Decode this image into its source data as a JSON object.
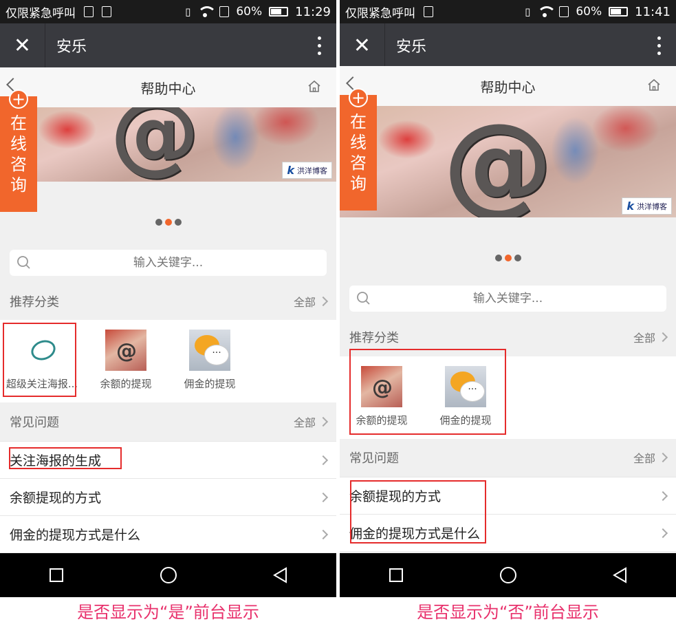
{
  "status_bar": {
    "carrier": "仅限紧急呼叫",
    "battery": "60%",
    "time_left": "11:29",
    "time_right": "11:41"
  },
  "app_bar": {
    "title": "安乐"
  },
  "page": {
    "title": "帮助中心"
  },
  "float_button": {
    "label": "在线咨询"
  },
  "banner": {
    "symbol": "@",
    "brand": "洪洋博客"
  },
  "search": {
    "placeholder": "输入关键字..."
  },
  "sections": {
    "categories_title": "推荐分类",
    "faq_title": "常见问题",
    "all_label": "全部"
  },
  "left": {
    "categories": [
      {
        "label": "超级关注海报...",
        "thumb": "qr-logo"
      },
      {
        "label": "余额的提现",
        "thumb": "money-at"
      },
      {
        "label": "佣金的提现",
        "thumb": "chat-bubbles"
      }
    ],
    "faq": [
      "关注海报的生成",
      "余额提现的方式",
      "佣金的提现方式是什么"
    ],
    "caption": "是否显示为“是”前台显示"
  },
  "right": {
    "categories": [
      {
        "label": "余额的提现",
        "thumb": "money-at"
      },
      {
        "label": "佣金的提现",
        "thumb": "chat-bubbles"
      }
    ],
    "faq": [
      "余额提现的方式",
      "佣金的提现方式是什么"
    ],
    "caption": "是否显示为“否”前台显示"
  },
  "colors": {
    "accent": "#f1662c",
    "highlight": "#e52b2b",
    "caption": "#e8316c",
    "appbar": "#393a3f"
  }
}
